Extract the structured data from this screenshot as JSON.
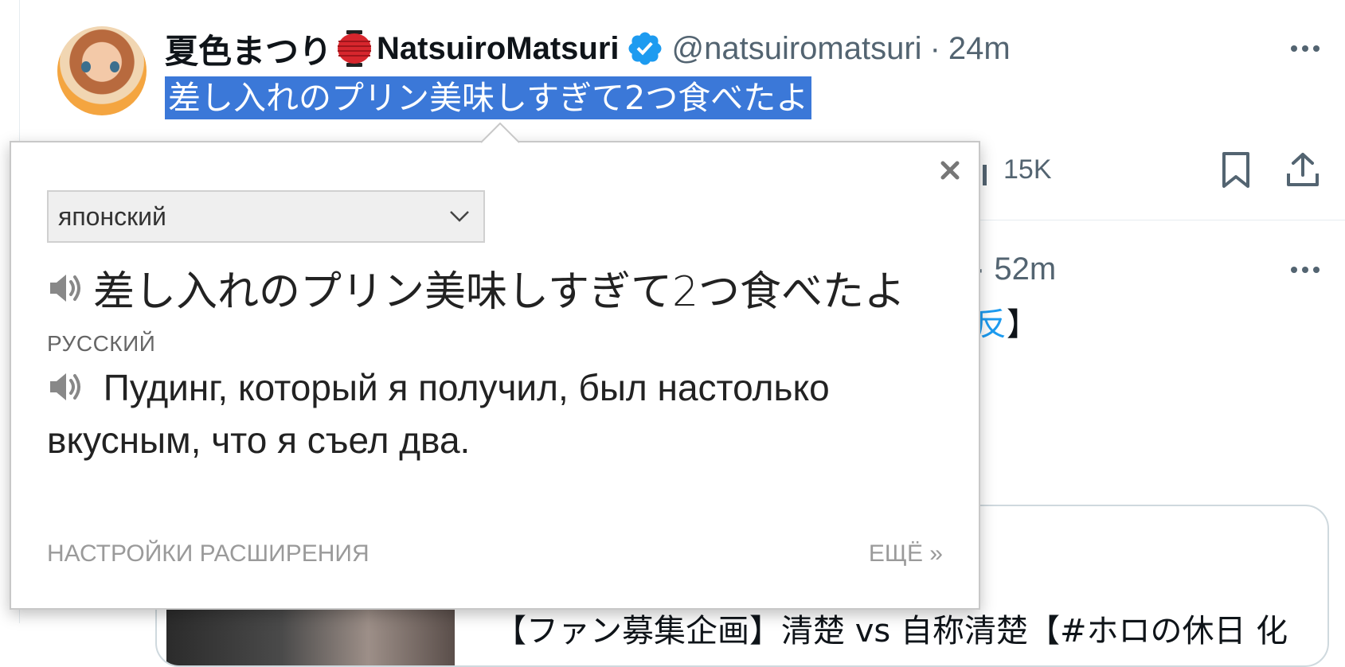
{
  "tweet1": {
    "author_name_ja": "夏色まつり",
    "author_name_en": "NatsuiroMatsuri",
    "handle": "@natsuiromatsuri",
    "separator": "·",
    "time": "24m",
    "text": "差し入れのプリン美味しすぎて2つ食べたよ",
    "views": "15K"
  },
  "tweet2": {
    "time": "· 52m",
    "text_link": "反",
    "text_bracket": "】"
  },
  "card": {
    "title": "【ファン募集企画】清楚 vs 自称清楚【#ホロの休日 化"
  },
  "translator": {
    "source_language": "японский",
    "source_text": "差し入れのプリン美味しすぎて2つ食べたよ",
    "target_language_label": "РУССКИЙ",
    "target_text": "Пудинг, который я получил, был настолько вкусным, что я съел два.",
    "extension_settings": "НАСТРОЙКИ РАСШИРЕНИЯ",
    "more_link": "ЕЩЁ »"
  },
  "colors": {
    "selection": "#3b78d8",
    "verified": "#1d9bf0",
    "muted_text": "#536471"
  }
}
